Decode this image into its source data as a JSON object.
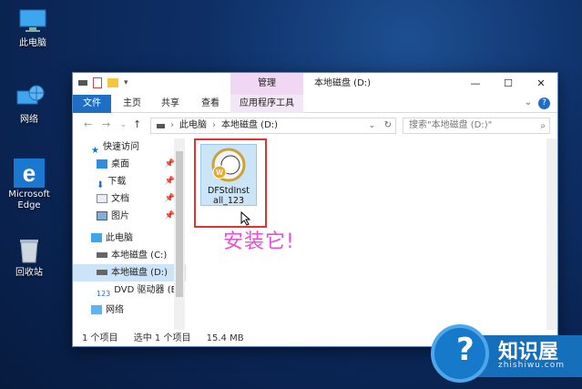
{
  "desktop": {
    "icons": [
      {
        "label": "此电脑",
        "icon": "this-pc-icon"
      },
      {
        "label": "网络",
        "icon": "network-icon"
      },
      {
        "label": "Microsoft Edge",
        "icon": "edge-icon"
      },
      {
        "label": "回收站",
        "icon": "recycle-bin-icon"
      }
    ]
  },
  "window": {
    "title": "本地磁盘 (D:)",
    "context_tab_group": "管理",
    "ribbon_tabs": [
      "文件",
      "主页",
      "共享",
      "查看",
      "应用程序工具"
    ],
    "address": {
      "root": "此电脑",
      "current": "本地磁盘 (D:)"
    },
    "search_placeholder": "搜索\"本地磁盘 (D:)\"",
    "sidebar": {
      "quick_access": "快速访问",
      "items": [
        "桌面",
        "下载",
        "文档",
        "图片"
      ],
      "this_pc": "此电脑",
      "drives": [
        "本地磁盘 (C:)",
        "本地磁盘 (D:)",
        "DVD 驱动器 (E:)"
      ],
      "network": "网络"
    },
    "file": {
      "name": "DFStdInstall_123",
      "line1": "DFStdInst",
      "line2": "all_123"
    },
    "status": {
      "count": "1 个项目",
      "selected": "选中 1 个项目",
      "size": "15.4 MB"
    }
  },
  "overlay_text": "安装它!",
  "watermark": {
    "title": "知识屋",
    "url": "zhishiwu.com"
  },
  "colors": {
    "accent": "#1e6fc4",
    "context_tab": "#f0d7f3",
    "highlight": "#d33333",
    "overlay_text": "#e84fd7"
  }
}
